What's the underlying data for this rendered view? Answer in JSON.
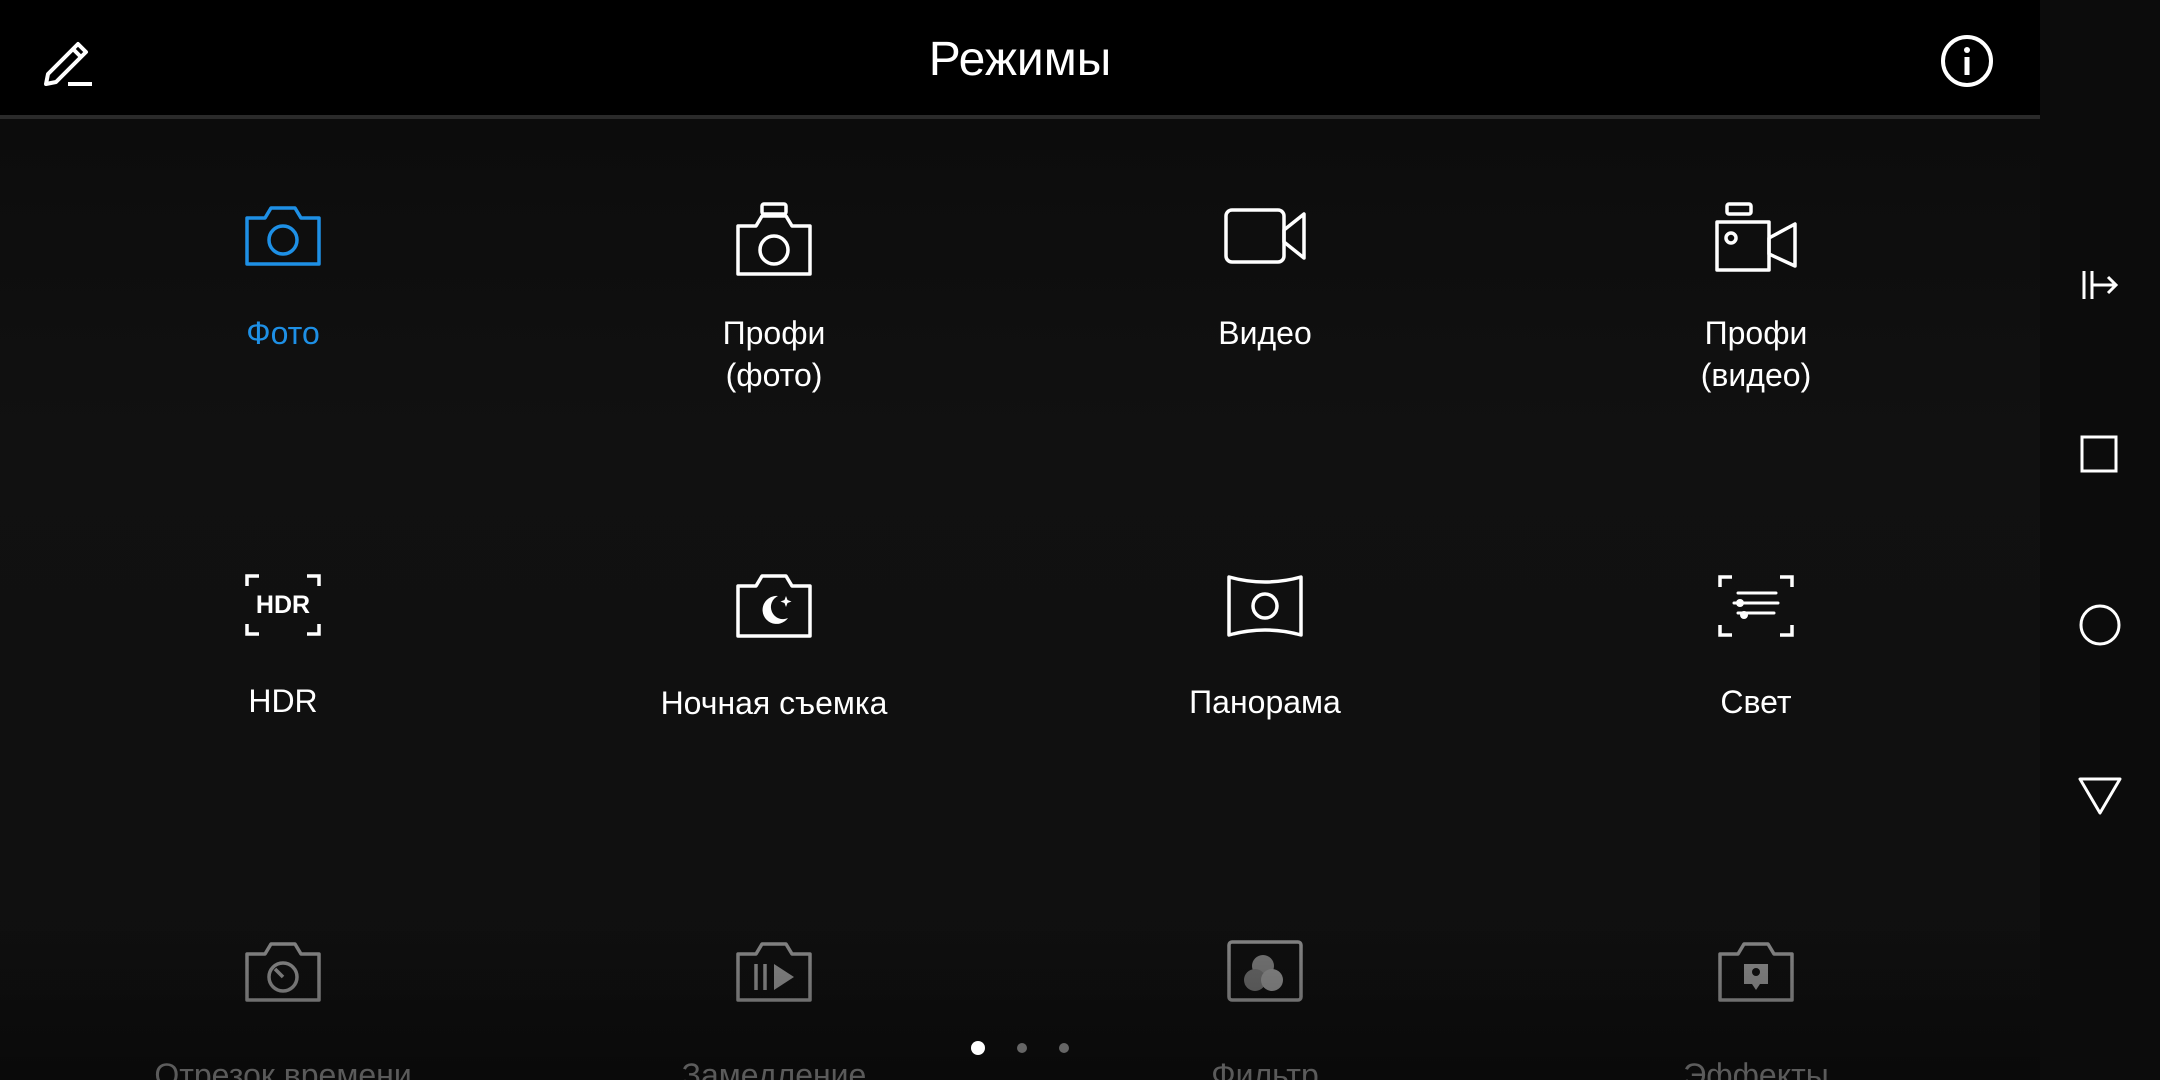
{
  "header": {
    "title": "Режимы",
    "edit_icon": "pencil-icon",
    "info_icon": "info-icon"
  },
  "modes": [
    {
      "label": "Фото",
      "icon": "camera-icon",
      "active": true
    },
    {
      "label": "Профи\n(фото)",
      "icon": "pro-camera-icon",
      "active": false
    },
    {
      "label": "Видео",
      "icon": "video-camera-icon",
      "active": false
    },
    {
      "label": "Профи\n(видео)",
      "icon": "pro-video-camera-icon",
      "active": false
    },
    {
      "label": "HDR",
      "icon": "hdr-icon",
      "active": false
    },
    {
      "label": "Ночная съемка",
      "icon": "night-mode-icon",
      "active": false
    },
    {
      "label": "Панорама",
      "icon": "panorama-icon",
      "active": false
    },
    {
      "label": "Свет",
      "icon": "light-painting-icon",
      "active": false
    },
    {
      "label": "Отрезок времени",
      "icon": "timelapse-icon",
      "active": false
    },
    {
      "label": "Замедление",
      "icon": "slow-motion-icon",
      "active": false
    },
    {
      "label": "Фильтр",
      "icon": "filter-icon",
      "active": false
    },
    {
      "label": "Эффекты",
      "icon": "effects-icon",
      "active": false
    }
  ],
  "pagination": {
    "pages": 3,
    "current": 1
  },
  "navbar": {
    "icons": [
      "sidebar-toggle-icon",
      "recents-square-icon",
      "home-circle-icon",
      "back-triangle-icon"
    ]
  },
  "colors": {
    "accent": "#1e90e6",
    "background": "#000000",
    "text": "#ffffff"
  }
}
